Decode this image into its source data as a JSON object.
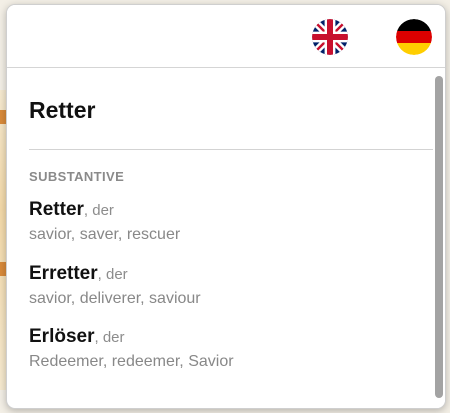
{
  "header": {
    "flags": [
      {
        "icon": "uk-flag-icon",
        "label": "English"
      },
      {
        "icon": "german-flag-icon",
        "label": "German"
      }
    ]
  },
  "headword": "Retter",
  "section": {
    "label": "SUBSTANTIVE",
    "entries": [
      {
        "word": "Retter",
        "article": ", der",
        "translations": "savior, saver, rescuer"
      },
      {
        "word": "Erretter",
        "article": ", der",
        "translations": "savior, deliverer, saviour"
      },
      {
        "word": "Erlöser",
        "article": ", der",
        "translations": "Redeemer, redeemer, Savior"
      }
    ]
  },
  "colors": {
    "headword": "#111111",
    "muted": "#888888",
    "divider": "#d3d3d3",
    "scrollbar": "#a3a3a3"
  }
}
